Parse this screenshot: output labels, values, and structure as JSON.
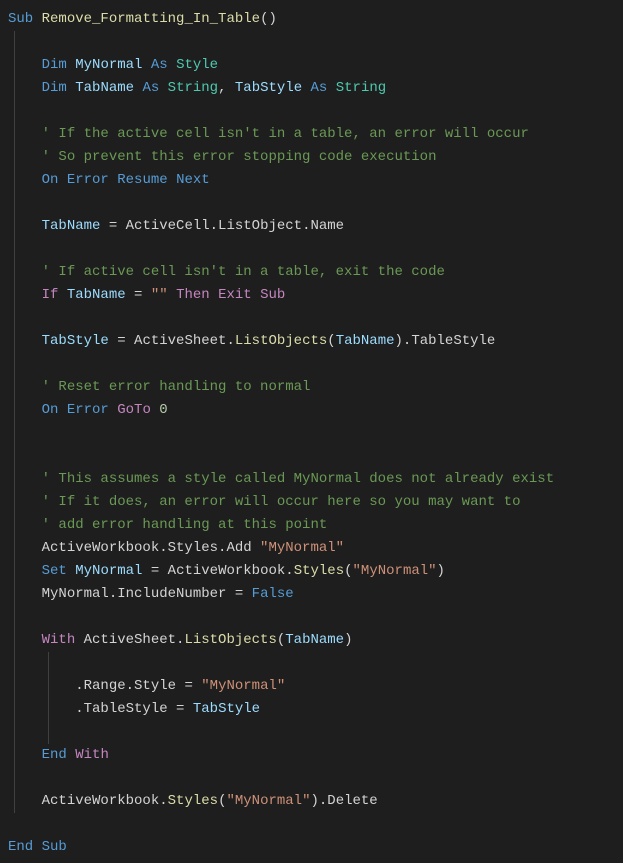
{
  "code": {
    "l0_sub": "Sub",
    "l0_name": "Remove_Formatting_In_Table",
    "l0_parens": "()",
    "l2_dim": "Dim",
    "l2_var": "MyNormal",
    "l2_as": "As",
    "l2_type": "Style",
    "l3_dim": "Dim",
    "l3_var1": "TabName",
    "l3_as1": "As",
    "l3_type1": "String",
    "l3_comma": ", ",
    "l3_var2": "TabStyle",
    "l3_as2": "As",
    "l3_type2": "String",
    "l5_comment": "' If the active cell isn't in a table, an error will occur",
    "l6_comment": "' So prevent this error stopping code execution",
    "l7_on": "On",
    "l7_error": "Error",
    "l7_resume": "Resume",
    "l7_next": "Next",
    "l9_var": "TabName",
    "l9_eq": " = ",
    "l9_obj": "ActiveCell.ListObject.Name",
    "l11_comment": "' If active cell isn't in a table, exit the code",
    "l12_if": "If",
    "l12_var": "TabName",
    "l12_eq": " = ",
    "l12_str": "\"\"",
    "l12_then": "Then",
    "l12_exit": "Exit Sub",
    "l14_var": "TabStyle",
    "l14_eq": " = ",
    "l14_pre": "ActiveSheet.",
    "l14_fn": "ListObjects",
    "l14_open": "(",
    "l14_arg": "TabName",
    "l14_close": ")",
    "l14_suffix": ".TableStyle",
    "l16_comment": "' Reset error handling to normal",
    "l17_on": "On",
    "l17_error": "Error",
    "l17_goto": "GoTo",
    "l17_zero": "0",
    "l20_comment": "' This assumes a style called MyNormal does not already exist",
    "l21_comment": "' If it does, an error will occur here so you may want to",
    "l22_comment": "' add error handling at this point",
    "l23_pre": "ActiveWorkbook.Styles.Add ",
    "l23_str": "\"MyNormal\"",
    "l24_set": "Set",
    "l24_var": "MyNormal",
    "l24_eq": " = ",
    "l24_pre": "ActiveWorkbook.",
    "l24_fn": "Styles",
    "l24_open": "(",
    "l24_str": "\"MyNormal\"",
    "l24_close": ")",
    "l25_obj": "MyNormal.IncludeNumber",
    "l25_eq": " = ",
    "l25_val": "False",
    "l27_with": "With",
    "l27_pre": " ActiveSheet.",
    "l27_fn": "ListObjects",
    "l27_open": "(",
    "l27_arg": "TabName",
    "l27_close": ")",
    "l29_prop": ".Range.Style",
    "l29_eq": " = ",
    "l29_str": "\"MyNormal\"",
    "l30_prop": ".TableStyle",
    "l30_eq": " = ",
    "l30_var": "TabStyle",
    "l32_end": "End",
    "l32_with": "With",
    "l34_pre": "ActiveWorkbook.",
    "l34_fn": "Styles",
    "l34_open": "(",
    "l34_str": "\"MyNormal\"",
    "l34_close": ")",
    "l34_suffix": ".Delete",
    "l36_end": "End Sub"
  }
}
